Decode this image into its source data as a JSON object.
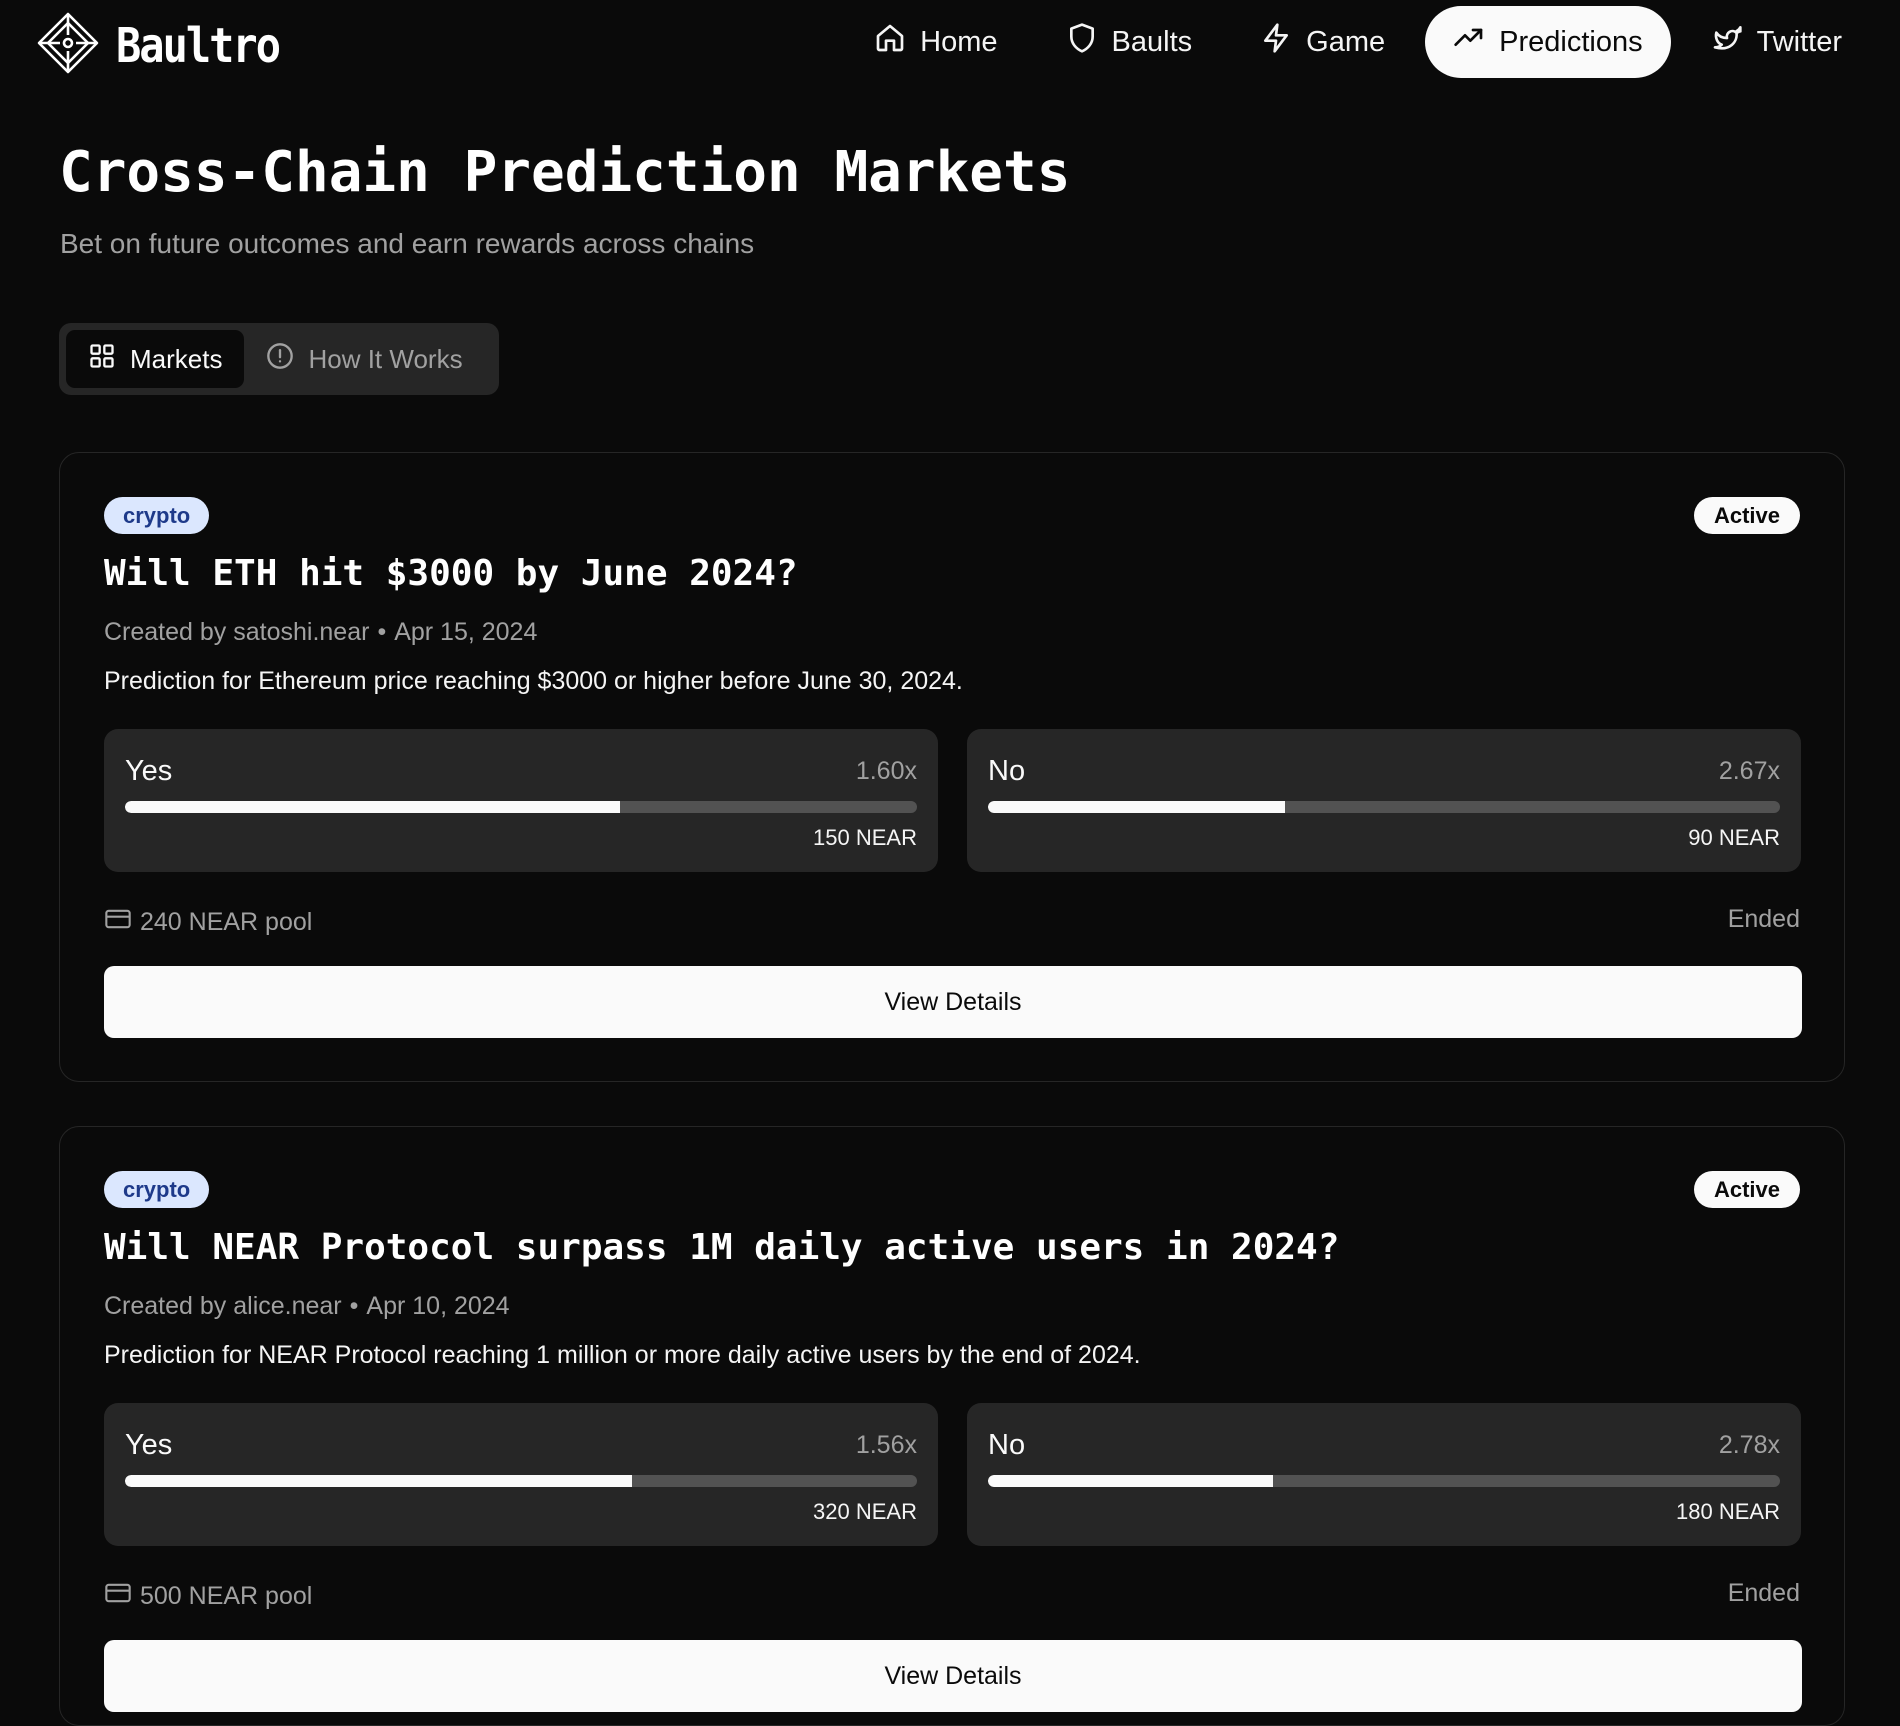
{
  "brand": {
    "name": "Baultro",
    "logo_icon": "diamond-logo-icon"
  },
  "nav": {
    "items": [
      {
        "label": "Home",
        "icon": "home-icon",
        "active": false
      },
      {
        "label": "Baults",
        "icon": "shield-icon",
        "active": false
      },
      {
        "label": "Game",
        "icon": "lightning-icon",
        "active": false
      },
      {
        "label": "Predictions",
        "icon": "trending-up-icon",
        "active": true
      },
      {
        "label": "Twitter",
        "icon": "twitter-icon",
        "active": false
      }
    ]
  },
  "header": {
    "title": "Cross-Chain Prediction Markets",
    "subtitle": "Bet on future outcomes and earn rewards across chains"
  },
  "tabs": [
    {
      "label": "Markets",
      "icon": "grid-icon",
      "active": true
    },
    {
      "label": "How It Works",
      "icon": "info-circle-icon",
      "active": false
    }
  ],
  "markets": [
    {
      "category": "crypto",
      "status": "Active",
      "title": "Will ETH hit $3000 by June 2024?",
      "created_by": "Created by satoshi.near",
      "date": "Apr 15, 2024",
      "description": "Prediction for Ethereum price reaching $3000 or higher before June 30, 2024.",
      "outcomes": [
        {
          "label": "Yes",
          "odds": "1.60x",
          "amount": "150 NEAR",
          "share": 0.625
        },
        {
          "label": "No",
          "odds": "2.67x",
          "amount": "90 NEAR",
          "share": 0.375
        }
      ],
      "pool": "240 NEAR pool",
      "end_status": "Ended",
      "button_label": "View Details"
    },
    {
      "category": "crypto",
      "status": "Active",
      "title": "Will NEAR Protocol surpass 1M daily active users in 2024?",
      "created_by": "Created by alice.near",
      "date": "Apr 10, 2024",
      "description": "Prediction for NEAR Protocol reaching 1 million or more daily active users by the end of 2024.",
      "outcomes": [
        {
          "label": "Yes",
          "odds": "1.56x",
          "amount": "320 NEAR",
          "share": 0.64
        },
        {
          "label": "No",
          "odds": "2.78x",
          "amount": "180 NEAR",
          "share": 0.36
        }
      ],
      "pool": "500 NEAR pool",
      "end_status": "Ended",
      "button_label": "View Details"
    }
  ],
  "colors": {
    "background": "#0a0a0a",
    "surface": "#262626",
    "category_badge_bg": "#dbe7fe",
    "category_badge_text": "#1e3a8a",
    "muted_text": "#a1a1a1"
  }
}
